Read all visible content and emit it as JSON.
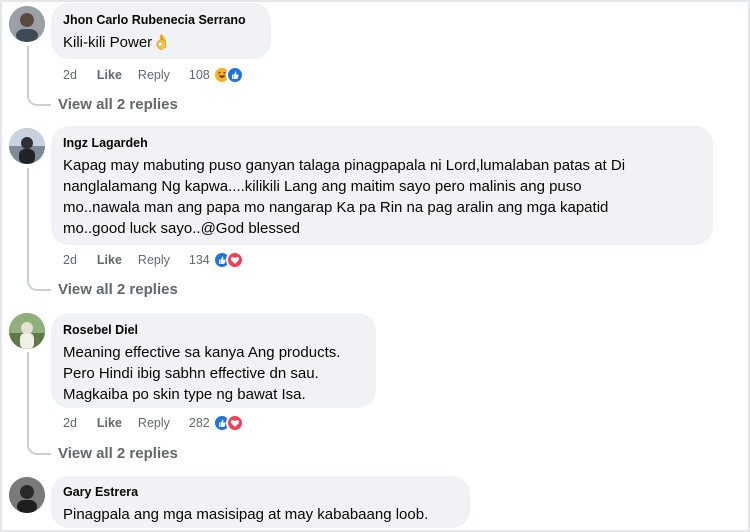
{
  "comments": [
    {
      "author": "Jhon Carlo Rubenecia Serrano",
      "text": "Kili-kili Power👌",
      "time": "2d",
      "like_label": "Like",
      "reply_label": "Reply",
      "reaction_count": "108",
      "reactions": [
        "haha",
        "like"
      ],
      "view_replies": "View all 2 replies"
    },
    {
      "author": "Ingz Lagardeh",
      "text_lines": [
        "Kapag may mabuting puso ganyan talaga pinagpapala ni Lord,lumalaban patas at Di",
        "nanglalamang Ng kapwa....kilikili Lang ang maitim sayo pero malinis ang puso",
        "mo..nawala man ang papa mo nangarap Ka pa Rin na pag aralin ang mga kapatid",
        "mo..good luck sayo..@God blessed"
      ],
      "time": "2d",
      "like_label": "Like",
      "reply_label": "Reply",
      "reaction_count": "134",
      "reactions": [
        "like",
        "love"
      ],
      "view_replies": "View all 2 replies"
    },
    {
      "author": "Rosebel Diel",
      "text_lines": [
        "Meaning effective sa kanya Ang products.",
        "Pero Hindi ibig sabhn effective dn sau.",
        "Magkaiba po skin type ng bawat Isa."
      ],
      "time": "2d",
      "like_label": "Like",
      "reply_label": "Reply",
      "reaction_count": "282",
      "reactions": [
        "like",
        "love"
      ],
      "view_replies": "View all 2 replies"
    },
    {
      "author": "Gary Estrera",
      "text": "Pinagpala ang mga masisipag at may kababaang loob."
    }
  ],
  "colors": {
    "bubble": "#f0f2f5",
    "meta_text": "#65676b",
    "like_blue": "#1b74e4",
    "love_red": "#f33e58",
    "haha_yellow": "#f7b125"
  }
}
